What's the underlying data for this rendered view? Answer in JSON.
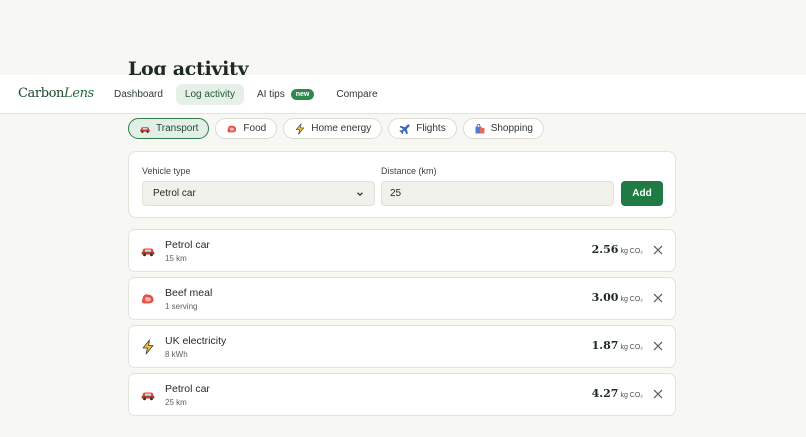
{
  "page": {
    "title": "Log activity"
  },
  "brand": {
    "part1": "Carbon",
    "part2": "Lens"
  },
  "nav": {
    "items": [
      {
        "label": "Dashboard"
      },
      {
        "label": "Log activity",
        "active": true
      },
      {
        "label": "AI tips",
        "badge": "new"
      },
      {
        "label": "Compare"
      }
    ]
  },
  "categories": [
    {
      "label": "Transport",
      "icon": "car-icon",
      "active": true
    },
    {
      "label": "Food",
      "icon": "steak-icon"
    },
    {
      "label": "Home energy",
      "icon": "lightning-icon"
    },
    {
      "label": "Flights",
      "icon": "airplane-icon"
    },
    {
      "label": "Shopping",
      "icon": "shopping-bag-icon"
    }
  ],
  "form": {
    "vehicle_label": "Vehicle type",
    "vehicle_value": "Petrol car",
    "distance_label": "Distance (km)",
    "distance_value": "25",
    "add_label": "Add"
  },
  "entries": [
    {
      "title": "Petrol car",
      "detail": "15 km",
      "value": "2.56",
      "unit": "kg CO₂",
      "icon": "car-icon"
    },
    {
      "title": "Beef meal",
      "detail": "1 serving",
      "value": "3.00",
      "unit": "kg CO₂",
      "icon": "steak-icon"
    },
    {
      "title": "UK electricity",
      "detail": "8 kWh",
      "value": "1.87",
      "unit": "kg CO₂",
      "icon": "lightning-icon"
    },
    {
      "title": "Petrol car",
      "detail": "25 km",
      "value": "4.27",
      "unit": "kg CO₂",
      "icon": "car-icon"
    }
  ],
  "colors": {
    "accent": "#1f7a43",
    "badge": "#2d8a4e",
    "active_bg": "#e6f0e8",
    "background": "#f7f7f4"
  }
}
